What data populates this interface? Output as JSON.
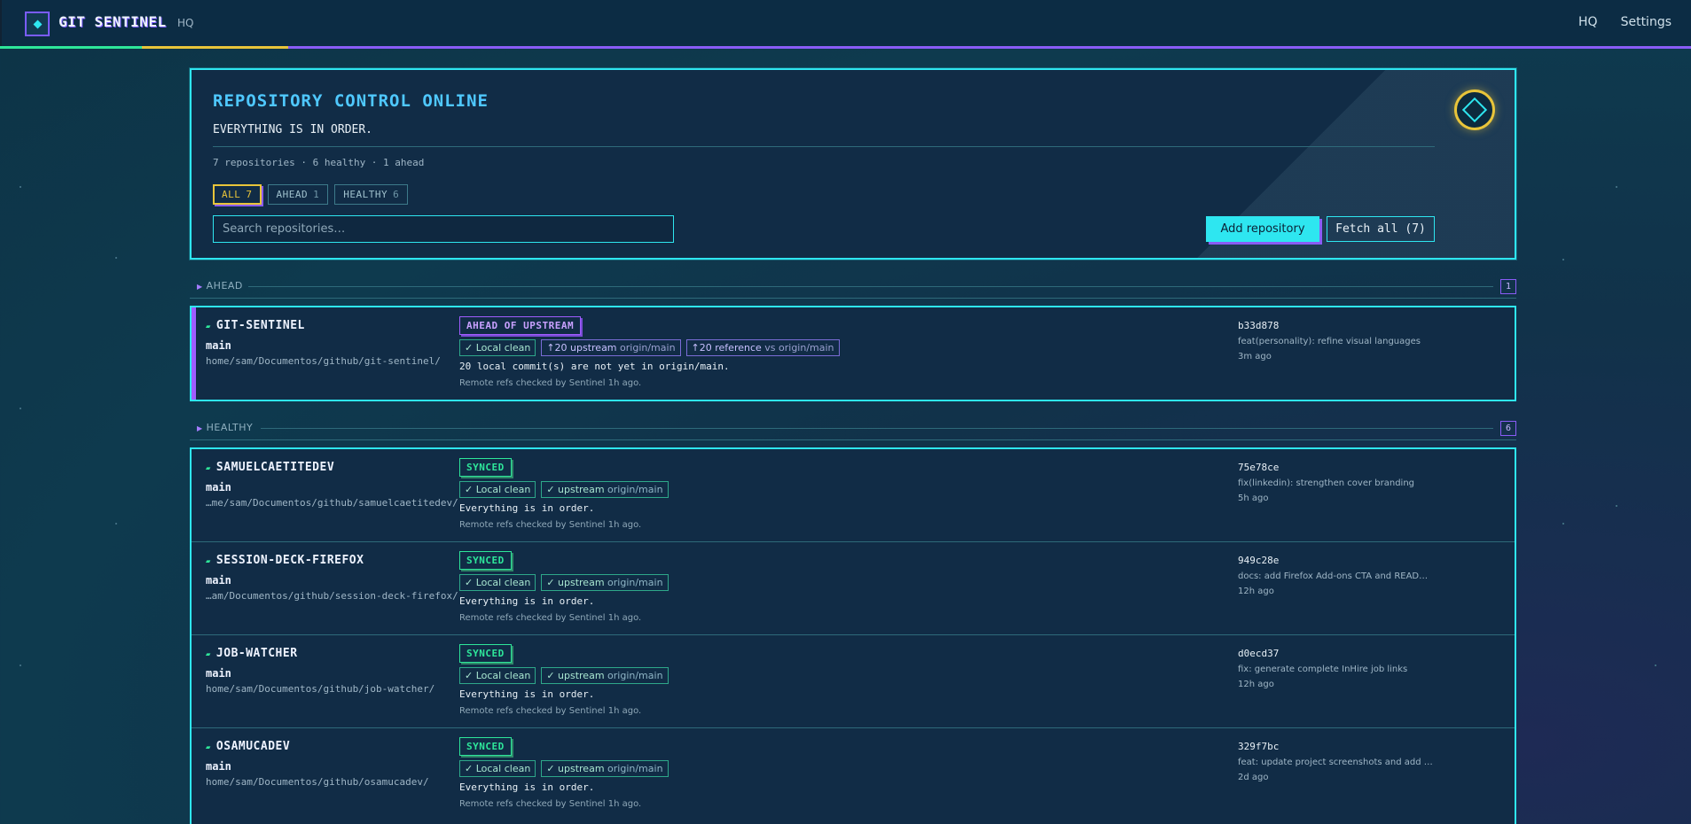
{
  "app": {
    "brand": "GIT SENTINEL",
    "brand_sub": "HQ",
    "nav": [
      "HQ",
      "Settings"
    ]
  },
  "hero": {
    "title": "REPOSITORY CONTROL ONLINE",
    "subtitle": "EVERYTHING IS IN ORDER.",
    "stats": "7 repositories · 6 healthy · 1 ahead",
    "filters": [
      {
        "label": "ALL",
        "count": "7",
        "active": true
      },
      {
        "label": "AHEAD",
        "count": "1",
        "active": false
      },
      {
        "label": "HEALTHY",
        "count": "6",
        "active": false
      }
    ],
    "search_placeholder": "Search repositories…",
    "add_label": "Add repository",
    "fetch_label": "Fetch all (7)"
  },
  "sections": {
    "ahead": {
      "label": "AHEAD",
      "count": "1"
    },
    "healthy": {
      "label": "HEALTHY",
      "count": "6"
    }
  },
  "repos_ahead": [
    {
      "name": "GIT-SENTINEL",
      "branch": "main",
      "path": "home/sam/Documentos/github/git-sentinel/",
      "status": "AHEAD OF UPSTREAM",
      "tags": {
        "local": "✓ Local clean",
        "upstream": "↑20 upstream",
        "upstream_ref": "origin/main",
        "reference": "↑20 reference",
        "reference_ref": "vs origin/main"
      },
      "message": "20 local commit(s) are not yet in origin/main.",
      "checked": "Remote refs checked by Sentinel 1h ago.",
      "sha": "b33d878",
      "commit_msg": "feat(personality): refine visual languages",
      "ago": "3m ago"
    }
  ],
  "repos_healthy": [
    {
      "name": "SAMUELCAETITEDEV",
      "branch": "main",
      "path": "…me/sam/Documentos/github/samuelcaetitedev/",
      "status": "SYNCED",
      "tags": {
        "local": "✓ Local clean",
        "upstream": "✓ upstream",
        "upstream_ref": "origin/main"
      },
      "message": "Everything is in order.",
      "checked": "Remote refs checked by Sentinel 1h ago.",
      "sha": "75e78ce",
      "commit_msg": "fix(linkedin): strengthen cover branding",
      "ago": "5h ago"
    },
    {
      "name": "SESSION-DECK-FIREFOX",
      "branch": "main",
      "path": "…am/Documentos/github/session-deck-firefox/",
      "status": "SYNCED",
      "tags": {
        "local": "✓ Local clean",
        "upstream": "✓ upstream",
        "upstream_ref": "origin/main"
      },
      "message": "Everything is in order.",
      "checked": "Remote refs checked by Sentinel 1h ago.",
      "sha": "949c28e",
      "commit_msg": "docs: add Firefox Add-ons CTA and READ…",
      "ago": "12h ago"
    },
    {
      "name": "JOB-WATCHER",
      "branch": "main",
      "path": "home/sam/Documentos/github/job-watcher/",
      "status": "SYNCED",
      "tags": {
        "local": "✓ Local clean",
        "upstream": "✓ upstream",
        "upstream_ref": "origin/main"
      },
      "message": "Everything is in order.",
      "checked": "Remote refs checked by Sentinel 1h ago.",
      "sha": "d0ecd37",
      "commit_msg": "fix: generate complete InHire job links",
      "ago": "12h ago"
    },
    {
      "name": "OSAMUCADEV",
      "branch": "main",
      "path": "home/sam/Documentos/github/osamucadev/",
      "status": "SYNCED",
      "tags": {
        "local": "✓ Local clean",
        "upstream": "✓ upstream",
        "upstream_ref": "origin/main"
      },
      "message": "Everything is in order.",
      "checked": "Remote refs checked by Sentinel 1h ago.",
      "sha": "329f7bc",
      "commit_msg": "feat: update project screenshots and add …",
      "ago": "2d ago"
    }
  ],
  "colors": {
    "accent_cyan": "#2ee6f0",
    "accent_purple": "#8a5cf6",
    "accent_yellow": "#e8c43a",
    "synced_green": "#2ee69a"
  }
}
